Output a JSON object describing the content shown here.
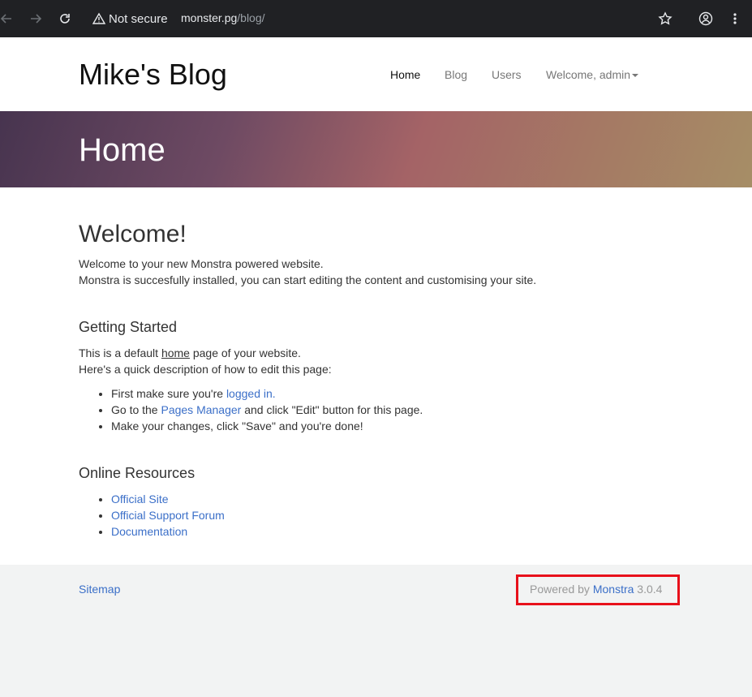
{
  "browser": {
    "security_label": "Not secure",
    "url_host": "monster.pg",
    "url_path": "/blog/"
  },
  "site": {
    "brand": "Mike's Blog",
    "nav": [
      {
        "label": "Home"
      },
      {
        "label": "Blog"
      },
      {
        "label": "Users"
      },
      {
        "label": "Welcome, admin"
      }
    ]
  },
  "hero": {
    "title": "Home"
  },
  "content": {
    "heading": "Welcome!",
    "intro_line1": "Welcome to your new Monstra powered website.",
    "intro_line2": "Monstra is succesfully installed, you can start editing the content and customising your site.",
    "getting_started": {
      "heading": "Getting Started",
      "line1_before": "This is a default ",
      "line1_underlined": "home",
      "line1_after": " page of your website.",
      "line2": "Here's a quick description of how to edit this page:",
      "steps": {
        "s1_before": "First make sure you're ",
        "s1_link": "logged in.",
        "s2_before": "Go to the ",
        "s2_link": "Pages Manager",
        "s2_after": " and click \"Edit\" button for this page.",
        "s3": "Make your changes, click \"Save\" and you're done!"
      }
    },
    "online_resources": {
      "heading": "Online Resources",
      "links": [
        "Official Site",
        "Official Support Forum",
        "Documentation"
      ]
    }
  },
  "footer": {
    "sitemap": "Sitemap",
    "powered_prefix": "Powered by ",
    "powered_link": "Monstra",
    "powered_version": " 3.0.4"
  },
  "colors": {
    "link": "#3b6fc8",
    "highlight": "#e8101b",
    "chrome_bg": "#202124"
  }
}
